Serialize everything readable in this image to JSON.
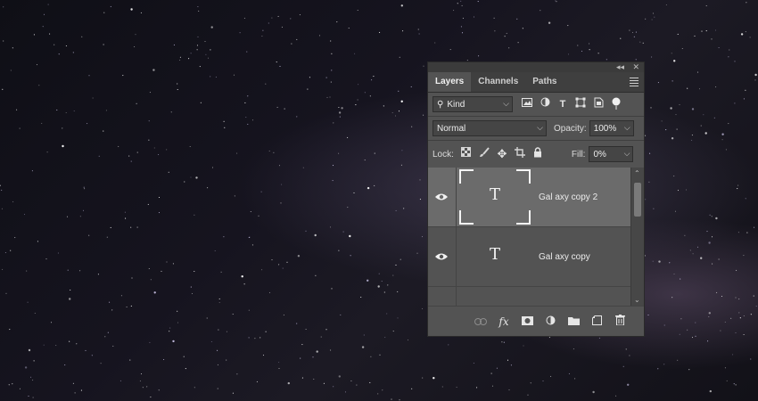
{
  "panel": {
    "controls": {
      "collapse": "◂◂",
      "close": "✕"
    },
    "tabs": [
      {
        "label": "Layers",
        "active": true
      },
      {
        "label": "Channels",
        "active": false
      },
      {
        "label": "Paths",
        "active": false
      }
    ],
    "filter": {
      "kind_label": "Kind"
    },
    "blend": {
      "mode": "Normal",
      "opacity_label": "Opacity:",
      "opacity": "100%"
    },
    "lock": {
      "label": "Lock:",
      "fill_label": "Fill:",
      "fill": "0%"
    },
    "layers": [
      {
        "name": "Gal axy copy 2",
        "selected": true,
        "type_glyph": "T"
      },
      {
        "name": "Gal axy copy",
        "selected": false,
        "type_glyph": "T"
      }
    ],
    "bottom_icons": [
      "link-icon",
      "fx-icon",
      "mask-icon",
      "adjustment-icon",
      "folder-icon",
      "new-layer-icon",
      "trash-icon"
    ],
    "fx_label": "fx"
  },
  "colors": {
    "panel_bg": "#535353",
    "selected_layer": "#6b6b6b",
    "tab_bar": "#3f3f3f"
  }
}
